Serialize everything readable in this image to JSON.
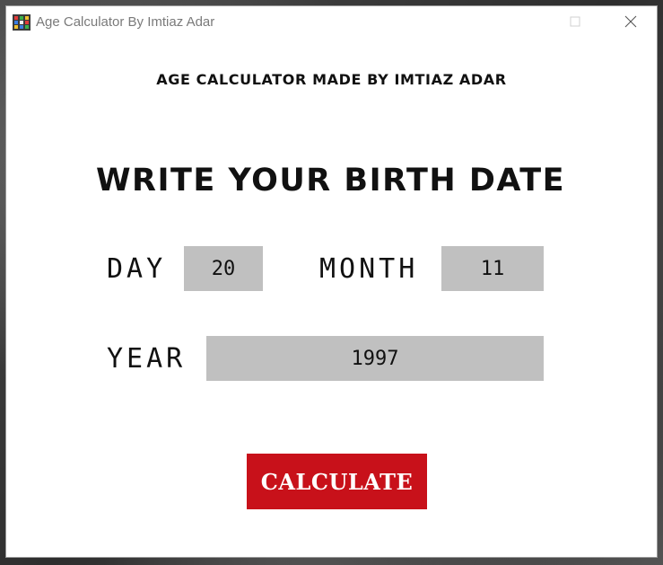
{
  "window": {
    "title": "Age Calculator By Imtiaz Adar",
    "icon": "app-icon"
  },
  "main": {
    "subtitle": "AGE CALCULATOR MADE BY IMTIAZ ADAR",
    "heading": "WRITE YOUR BIRTH DATE",
    "day_label": "DAY",
    "day_value": "20",
    "month_label": "MONTH",
    "month_value": "11",
    "year_label": "YEAR",
    "year_value": "1997",
    "calculate_label": "CALCULATE"
  },
  "colors": {
    "input_bg": "#c0c0c0",
    "button_bg": "#c8111a",
    "button_text": "#ffffff"
  }
}
